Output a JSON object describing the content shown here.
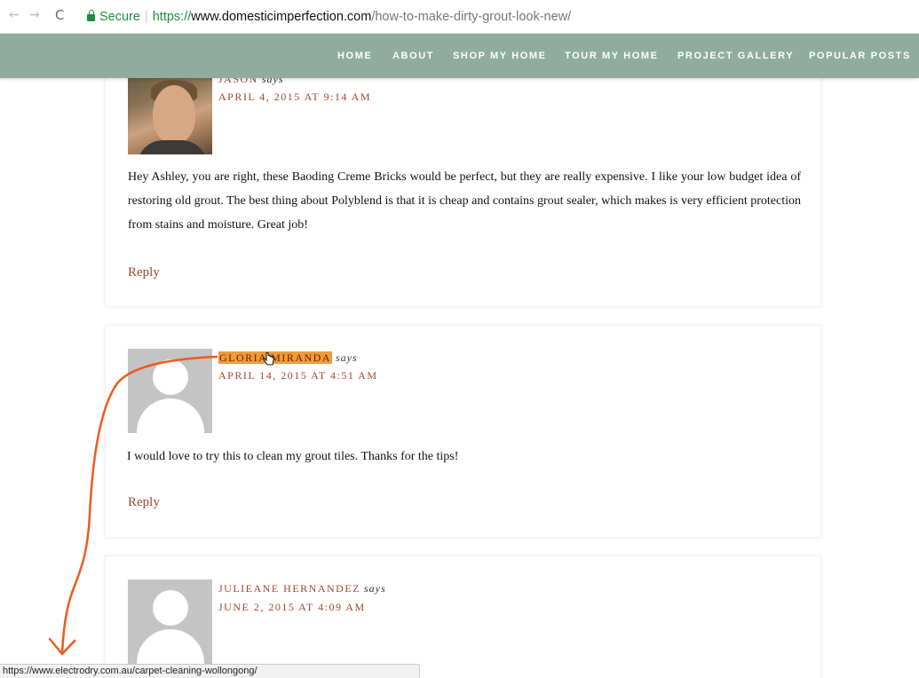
{
  "browser": {
    "back_glyph": "←",
    "forward_glyph": "→",
    "reload_glyph": "C",
    "secure_label": "Secure",
    "url_scheme": "https://",
    "url_host": "www.domesticimperfection.com",
    "url_path": "/how-to-make-dirty-grout-look-new/",
    "status_url": "https://www.electrodry.com.au/carpet-cleaning-wollongong/"
  },
  "site_nav": {
    "items": [
      "HOME",
      "ABOUT",
      "SHOP MY HOME",
      "TOUR MY HOME",
      "PROJECT GALLERY",
      "POPULAR POSTS"
    ]
  },
  "comments": [
    {
      "author": "JASON",
      "says": "says",
      "date": "APRIL 4, 2015 AT 9:14 AM",
      "text": "Hey Ashley, you are right, these Baoding Creme Bricks would be perfect, but they are really expensive. I like your low budget idea of restoring old grout. The best thing about Polyblend is that it is cheap and contains grout sealer, which makes is very efficient protection from stains and moisture. Great job!",
      "reply": "Reply"
    },
    {
      "author": "GLORIA MIRANDA",
      "says": "says",
      "date": "APRIL 14, 2015 AT 4:51 AM",
      "text": "I would love to try this to clean my grout tiles. Thanks for the tips!",
      "reply": "Reply"
    },
    {
      "author": "JULIEANE HERNANDEZ",
      "says": "says",
      "date": "JUNE 2, 2015 AT 4:09 AM"
    }
  ],
  "colors": {
    "nav_background": "#8fac9f",
    "link": "#a0462e",
    "highlight": "#f29a3a",
    "annotation_arrow": "#ee5b1c",
    "secure_green": "#1e8e3e"
  }
}
